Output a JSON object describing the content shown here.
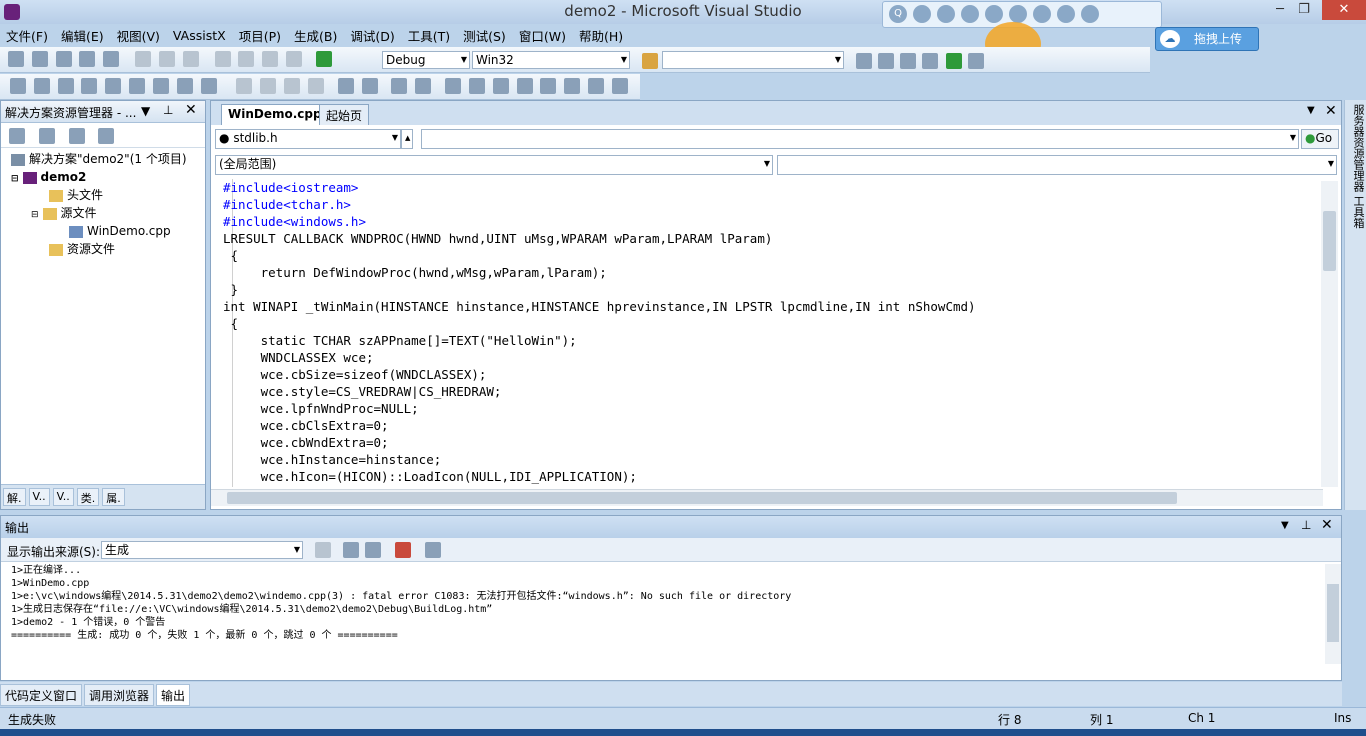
{
  "window": {
    "title": "demo2 - Microsoft Visual Studio",
    "min": "─",
    "max": "❐",
    "close": "✕"
  },
  "qqbar": {
    "upload": "拖拽上传",
    "upload_icon": "☁"
  },
  "menu": [
    "文件(F)",
    "编辑(E)",
    "视图(V)",
    "VAssistX",
    "项目(P)",
    "生成(B)",
    "调试(D)",
    "工具(T)",
    "测试(S)",
    "窗口(W)",
    "帮助(H)"
  ],
  "toolbar": {
    "config": "Debug",
    "platform": "Win32",
    "find": ""
  },
  "solution": {
    "title": "解决方案资源管理器 - ...",
    "items": [
      "解决方案\"demo2\"(1 个项目)",
      "demo2",
      "头文件",
      "源文件",
      "WinDemo.cpp",
      "资源文件"
    ],
    "tabs": [
      "解.",
      "V..",
      "V..",
      "类.",
      "属."
    ]
  },
  "editor": {
    "tabs": [
      "WinDemo.cpp",
      "起始页"
    ],
    "file_combo": "stdlib.h",
    "scope_combo": "(全局范围)",
    "go": "Go",
    "lines": [
      "#include<iostream>",
      "#include<tchar.h>",
      "#include<windows.h>",
      "LRESULT CALLBACK WNDPROC(HWND hwnd,UINT uMsg,WPARAM wParam,LPARAM lParam)",
      " {",
      "     return DefWindowProc(hwnd,wMsg,wParam,lParam);",
      " }",
      "int WINAPI _tWinMain(HINSTANCE hinstance,HINSTANCE hprevinstance,IN LPSTR lpcmdline,IN int nShowCmd)",
      " {",
      "     static TCHAR szAPPname[]=TEXT(\"HelloWin\");",
      "     WNDCLASSEX wce;",
      "     wce.cbSize=sizeof(WNDCLASSEX);",
      "     wce.style=CS_VREDRAW|CS_HREDRAW;",
      "     wce.lpfnWndProc=NULL;",
      "     wce.cbClsExtra=0;",
      "     wce.cbWndExtra=0;",
      "     wce.hInstance=hinstance;",
      "     wce.hIcon=(HICON)::LoadIcon(NULL,IDI_APPLICATION);"
    ]
  },
  "output": {
    "title": "输出",
    "source_label": "显示输出来源(S):",
    "source_value": "生成",
    "text": "1>正在编译...\n1>WinDemo.cpp\n1>e:\\vc\\windows编程\\2014.5.31\\demo2\\demo2\\windemo.cpp(3) : fatal error C1083: 无法打开包括文件:“windows.h”: No such file or directory\n1>生成日志保存在“file://e:\\VC\\windows编程\\2014.5.31\\demo2\\demo2\\Debug\\BuildLog.htm”\n1>demo2 - 1 个错误，0 个警告\n========== 生成: 成功 0 个，失败 1 个，最新 0 个，跳过 0 个 =========="
  },
  "bottom_tabs": [
    "代码定义窗口",
    "调用浏览器",
    "输出"
  ],
  "status": {
    "left": "生成失败",
    "line": "行 8",
    "col": "列 1",
    "ch": "Ch 1",
    "ins": "Ins"
  },
  "right_tabs": "服务器资源管理器  工具箱"
}
